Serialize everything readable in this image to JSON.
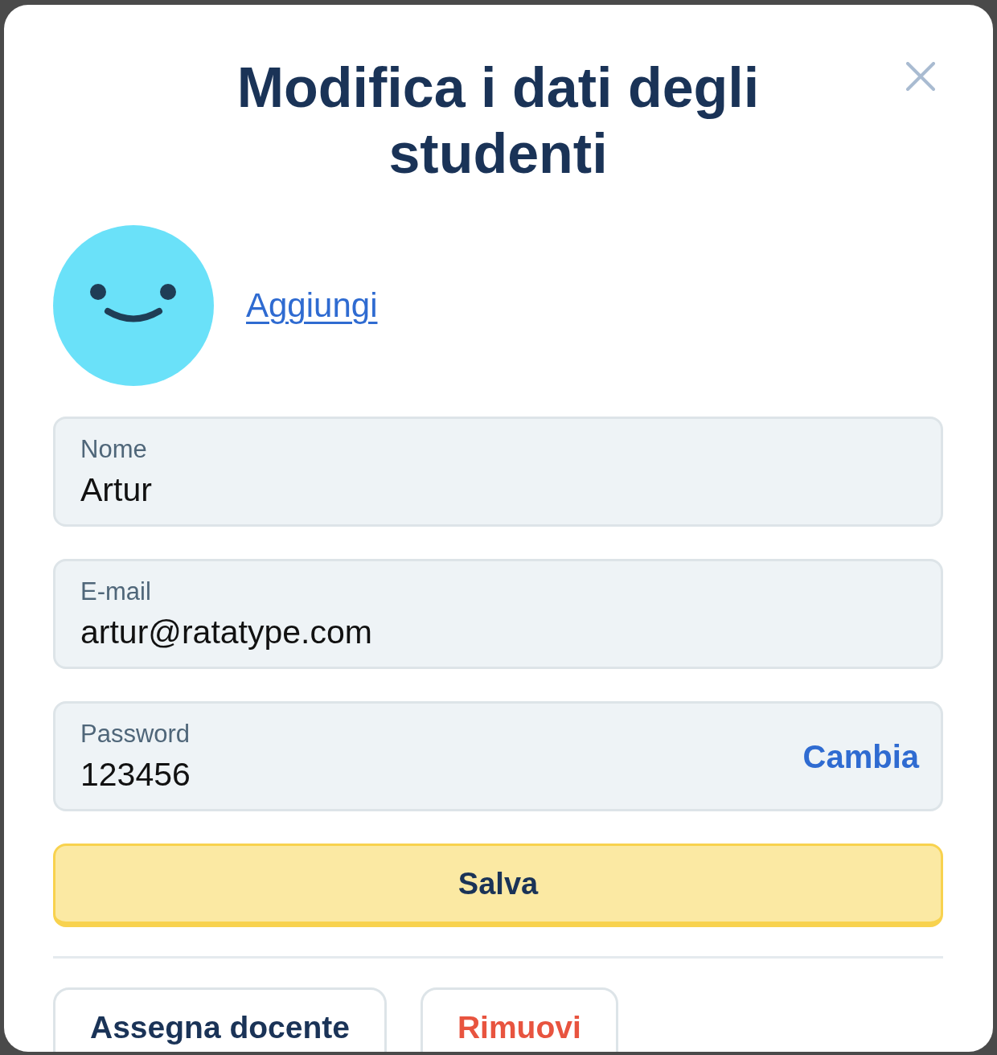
{
  "dialog": {
    "title": "Modifica i dati degli studenti"
  },
  "avatar": {
    "action": "Aggiungi"
  },
  "fields": [
    {
      "label": "Nome",
      "value": "Artur"
    },
    {
      "label": "E-mail",
      "value": "artur@ratatype.com"
    },
    {
      "label": "Password",
      "value": "123456",
      "action": "Cambia"
    }
  ],
  "primary_button": "Salva",
  "secondary_buttons": [
    {
      "label": "Assegna docente",
      "kind": "neutral"
    },
    {
      "label": "Rimuovi",
      "kind": "danger"
    }
  ]
}
